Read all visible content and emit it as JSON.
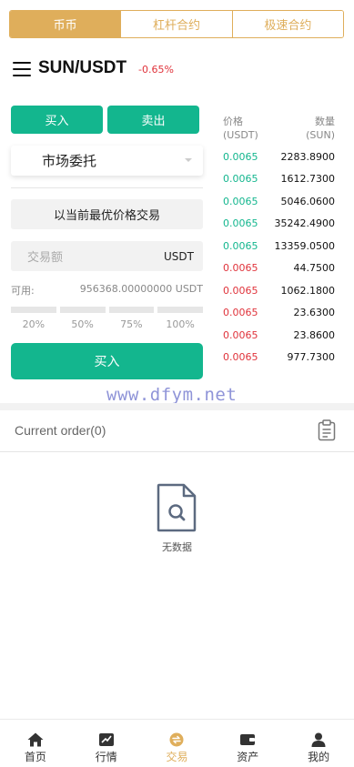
{
  "top_tabs": [
    "币币",
    "杠杆合约",
    "极速合约"
  ],
  "pair": {
    "name": "SUN/USDT",
    "change": "-0.65%"
  },
  "trade": {
    "buy_tab": "买入",
    "sell_tab": "卖出",
    "order_type": "市场委托",
    "best_price": "以当前最优价格交易",
    "amount_placeholder": "交易额",
    "amount_unit": "USDT",
    "available_label": "可用:",
    "available_value": "956368.00000000 USDT",
    "percents": [
      "20%",
      "50%",
      "75%",
      "100%"
    ],
    "submit": "买入"
  },
  "order_book": {
    "price_header_1": "价格",
    "price_header_2": "(USDT)",
    "qty_header_1": "数量",
    "qty_header_2": "(SUN)",
    "rows": [
      {
        "price": "0.0065",
        "qty": "2283.8900",
        "side": "buy"
      },
      {
        "price": "0.0065",
        "qty": "1612.7300",
        "side": "buy"
      },
      {
        "price": "0.0065",
        "qty": "5046.0600",
        "side": "buy"
      },
      {
        "price": "0.0065",
        "qty": "35242.4900",
        "side": "buy"
      },
      {
        "price": "0.0065",
        "qty": "13359.0500",
        "side": "buy"
      },
      {
        "price": "0.0065",
        "qty": "44.7500",
        "side": "sell"
      },
      {
        "price": "0.0065",
        "qty": "1062.1800",
        "side": "sell"
      },
      {
        "price": "0.0065",
        "qty": "23.6300",
        "side": "sell"
      },
      {
        "price": "0.0065",
        "qty": "23.8600",
        "side": "sell"
      },
      {
        "price": "0.0065",
        "qty": "977.7300",
        "side": "sell"
      }
    ]
  },
  "watermark": "www.dfym.net",
  "orders": {
    "title": "Current order(0)",
    "empty": "无数据"
  },
  "bottom_nav": [
    {
      "label": "首页",
      "icon": "home-icon"
    },
    {
      "label": "行情",
      "icon": "chart-icon"
    },
    {
      "label": "交易",
      "icon": "exchange-icon"
    },
    {
      "label": "资产",
      "icon": "wallet-icon"
    },
    {
      "label": "我的",
      "icon": "user-icon"
    }
  ],
  "colors": {
    "accent": "#dfae5b",
    "green": "#13b68e",
    "red": "#e0333b"
  }
}
